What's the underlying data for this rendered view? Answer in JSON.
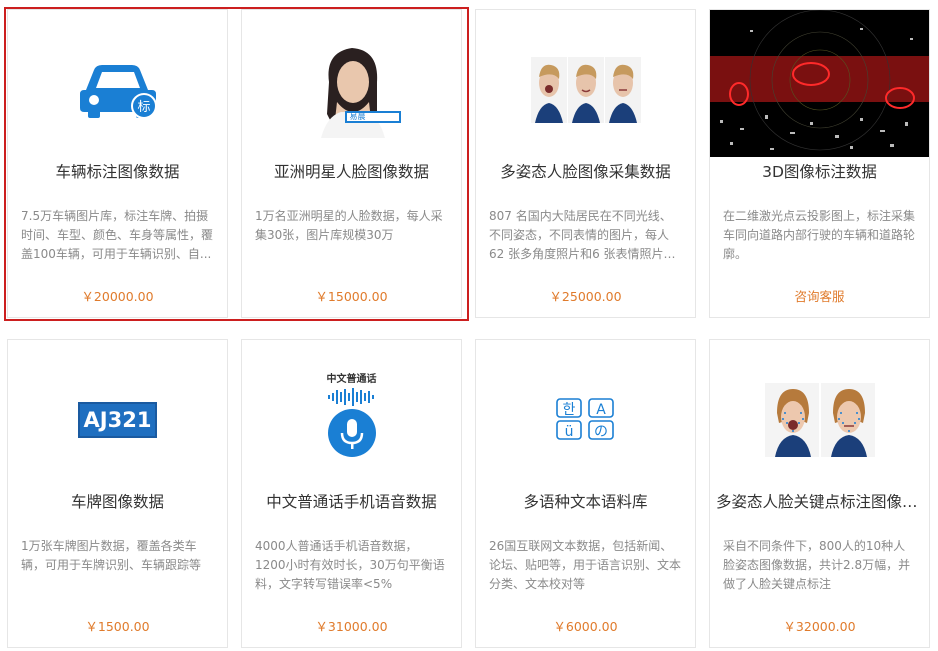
{
  "products": [
    {
      "title": "车辆标注图像数据",
      "desc": "7.5万车辆图片库，标注车牌、拍摄时间、车型、颜色、车身等属性，覆盖100车辆，可用于车辆识别、自...",
      "price": "￥20000.00"
    },
    {
      "title": "亚洲明星人脸图像数据",
      "desc": "1万名亚洲明星的人脸数据，每人采集30张，图片库规模30万",
      "price": "￥15000.00",
      "badge": "易晨"
    },
    {
      "title": "多姿态人脸图像采集数据",
      "desc": "807 名国内大陆居民在不同光线、不同姿态，不同表情的图片，每人 62 张多角度照片和6 张表情照片，总...",
      "price": "￥25000.00"
    },
    {
      "title": "3D图像标注数据",
      "desc": "在二维激光点云投影图上，标注采集车同向道路内部行驶的车辆和道路轮廓。",
      "price": "咨询客服"
    },
    {
      "title": "车牌图像数据",
      "desc": "1万张车牌图片数据，覆盖各类车辆，可用于车牌识别、车辆跟踪等",
      "price": "￥1500.00",
      "plate": "AJ321"
    },
    {
      "title": "中文普通话手机语音数据",
      "desc": "4000人普通话手机语音数据，1200小时有效时长，30万句平衡语料，文字转写错误率<5%",
      "price": "￥31000.00",
      "caption": "中文普通话"
    },
    {
      "title": "多语种文本语料库",
      "desc": "26国互联网文本数据，包括新闻、论坛、贴吧等，用于语言识别、文本分类、文本校对等",
      "price": "￥6000.00"
    },
    {
      "title": "多姿态人脸关键点标注图像数据",
      "desc": "采自不同条件下，800人的10种人脸姿态图像数据，共计2.8万幅，并做了人脸关键点标注",
      "price": "￥32000.00"
    }
  ],
  "badges": {
    "car": "标"
  },
  "icons": [
    "car-icon",
    "star-portrait",
    "multi-pose-faces",
    "lidar-3d-image",
    "license-plate-icon",
    "microphone-icon",
    "multilingual-text-icon",
    "face-keypoints-image"
  ],
  "colors": {
    "accent": "#1a7fd4",
    "price": "#e07b2c",
    "highlight": "#cc1f1f"
  }
}
